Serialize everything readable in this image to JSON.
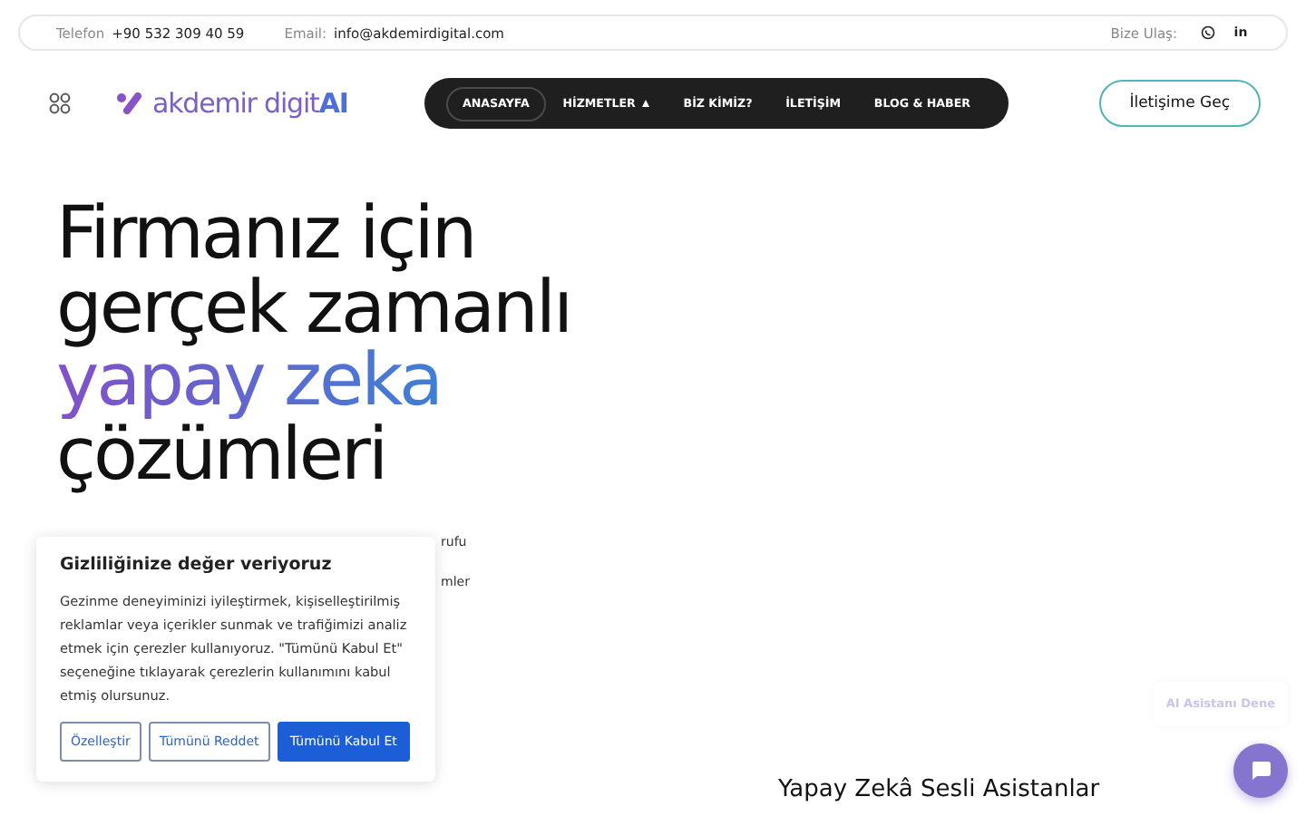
{
  "topbar": {
    "phone_label": "Telefon",
    "phone": "+90 532 309 40 59",
    "email_label": "Email:",
    "email": "info@akdemirdigital.com",
    "contact_label": "Bize Ulaş:",
    "social": [
      {
        "kind": "whatsapp"
      },
      {
        "kind": "linkedin",
        "text": "in"
      }
    ]
  },
  "header": {
    "logo": {
      "text": "akdemir digit",
      "accent": "AI"
    },
    "nav": [
      {
        "label": "ANASAYFA",
        "selected": true,
        "dropdown": false
      },
      {
        "label": "HİZMETLER",
        "selected": false,
        "dropdown": true
      },
      {
        "label": "BİZ KİMİZ?",
        "selected": false,
        "dropdown": false
      },
      {
        "label": "İLETİŞİM",
        "selected": false,
        "dropdown": false
      },
      {
        "label": "BLOG & HABER",
        "selected": false,
        "dropdown": false
      }
    ],
    "cta": "İletişime Geç"
  },
  "hero": {
    "title_lines": [
      {
        "text": "Firmanız için",
        "accent": false
      },
      {
        "text": "gerçek zamanlı",
        "accent": false
      },
      {
        "text": "yapay zeka",
        "accent": true
      },
      {
        "text": "çözümleri",
        "accent": false
      }
    ],
    "text_fragments": [
      "rufu",
      "mler"
    ],
    "subheading": "Yapay Zekâ Sesli Asistanlar"
  },
  "cookie_banner": {
    "title": "Gizliliğinize değer veriyoruz",
    "body": "Gezinme deneyiminizi iyileştirmek, kişiselleştirilmiş reklamlar veya içerikler sunmak ve trafiğimizi analiz etmek için çerezler kullanıyoruz. \"Tümünü Kabul Et\" seçeneğine tıklayarak çerezlerin kullanımını kabul etmiş olursunuz.",
    "buttons": [
      {
        "label": "Özelleştir",
        "primary": false
      },
      {
        "label": "Tümünü Reddet",
        "primary": false
      },
      {
        "label": "Tümünü Kabul Et",
        "primary": true
      }
    ]
  },
  "assistant": {
    "label": "AI Asistanı Dene"
  }
}
